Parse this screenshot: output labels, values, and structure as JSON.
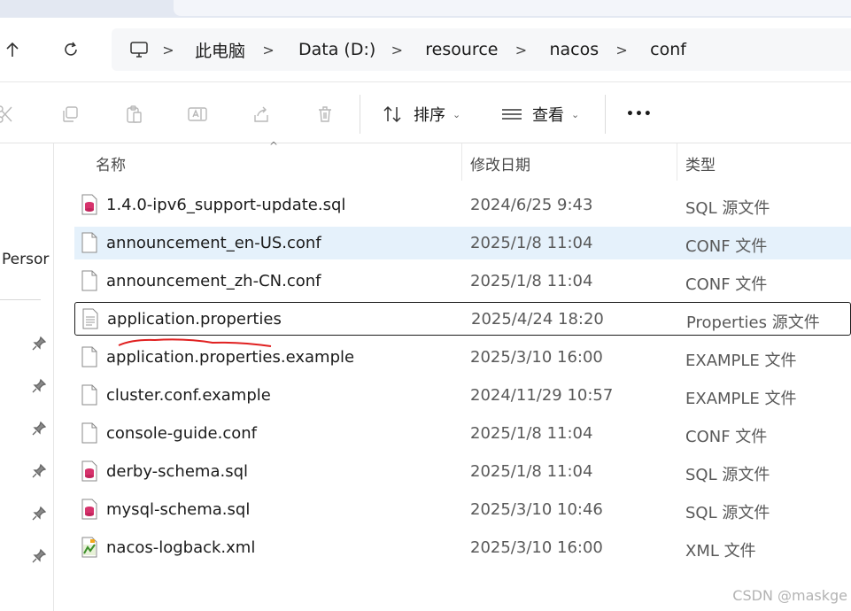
{
  "breadcrumb": {
    "items": [
      {
        "label": "此电脑"
      },
      {
        "label": "Data (D:)"
      },
      {
        "label": "resource"
      },
      {
        "label": "nacos"
      },
      {
        "label": "conf"
      }
    ],
    "separator": ">"
  },
  "toolbar": {
    "sort_label": "排序",
    "view_label": "查看",
    "more_label": "•••"
  },
  "navpane": {
    "person_label": "Persor"
  },
  "columns": {
    "name": "名称",
    "date": "修改日期",
    "type": "类型"
  },
  "files": [
    {
      "name": "1.4.0-ipv6_support-update.sql",
      "date": "2024/6/25 9:43",
      "type": "SQL 源文件",
      "icon": "sql-file-icon"
    },
    {
      "name": "announcement_en-US.conf",
      "date": "2025/1/8 11:04",
      "type": "CONF 文件",
      "icon": "file-icon",
      "state": "hover"
    },
    {
      "name": "announcement_zh-CN.conf",
      "date": "2025/1/8 11:04",
      "type": "CONF 文件",
      "icon": "file-icon"
    },
    {
      "name": "application.properties",
      "date": "2025/4/24 18:20",
      "type": "Properties 源文件",
      "icon": "text-file-icon",
      "state": "focused"
    },
    {
      "name": "application.properties.example",
      "date": "2025/3/10 16:00",
      "type": "EXAMPLE 文件",
      "icon": "file-icon"
    },
    {
      "name": "cluster.conf.example",
      "date": "2024/11/29 10:57",
      "type": "EXAMPLE 文件",
      "icon": "file-icon"
    },
    {
      "name": "console-guide.conf",
      "date": "2025/1/8 11:04",
      "type": "CONF 文件",
      "icon": "file-icon"
    },
    {
      "name": "derby-schema.sql",
      "date": "2025/1/8 11:04",
      "type": "SQL 源文件",
      "icon": "sql-file-icon"
    },
    {
      "name": "mysql-schema.sql",
      "date": "2025/3/10 10:46",
      "type": "SQL 源文件",
      "icon": "sql-file-icon"
    },
    {
      "name": "nacos-logback.xml",
      "date": "2025/3/10 16:00",
      "type": "XML 文件",
      "icon": "xml-file-icon"
    }
  ],
  "watermark": "CSDN @maskge",
  "colors": {
    "selected_row": "#e5f1fb",
    "annotation": "#e02020",
    "sql_icon": "#d6336c"
  }
}
